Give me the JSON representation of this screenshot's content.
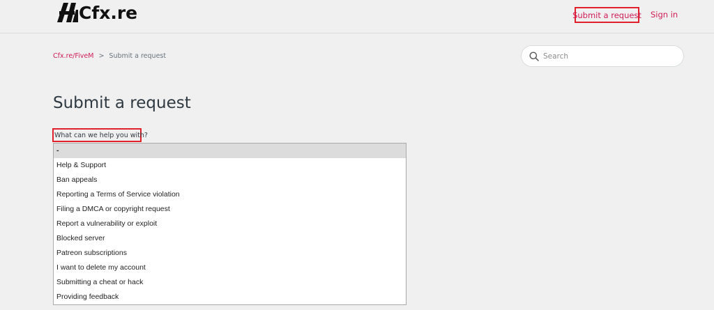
{
  "header": {
    "logo_text": "Cfx.re",
    "logo_icon": "cfx-logo-icon",
    "nav": {
      "submit_request_label": "Submit a request",
      "sign_in_label": "Sign in"
    }
  },
  "breadcrumb": {
    "items": [
      "Cfx.re/FiveM",
      "Submit a request"
    ],
    "separator": ">"
  },
  "search": {
    "placeholder": "Search",
    "icon": "search-icon"
  },
  "page_title": "Submit a request",
  "form": {
    "field_label": "What can we help you with?",
    "selected_value": "-",
    "options": [
      "-",
      "Help & Support",
      "Ban appeals",
      "Reporting a Terms of Service violation",
      "Filing a DMCA or copyright request",
      "Report a vulnerability or exploit",
      "Blocked server",
      "Patreon subscriptions",
      "I want to delete my account",
      "Submitting a cheat or hack",
      "Providing feedback"
    ]
  },
  "colors": {
    "accent": "#cf1c55",
    "highlight_box": "#e0202a",
    "background": "#f0f0f0",
    "selected_option_bg": "#dcdcdc"
  }
}
